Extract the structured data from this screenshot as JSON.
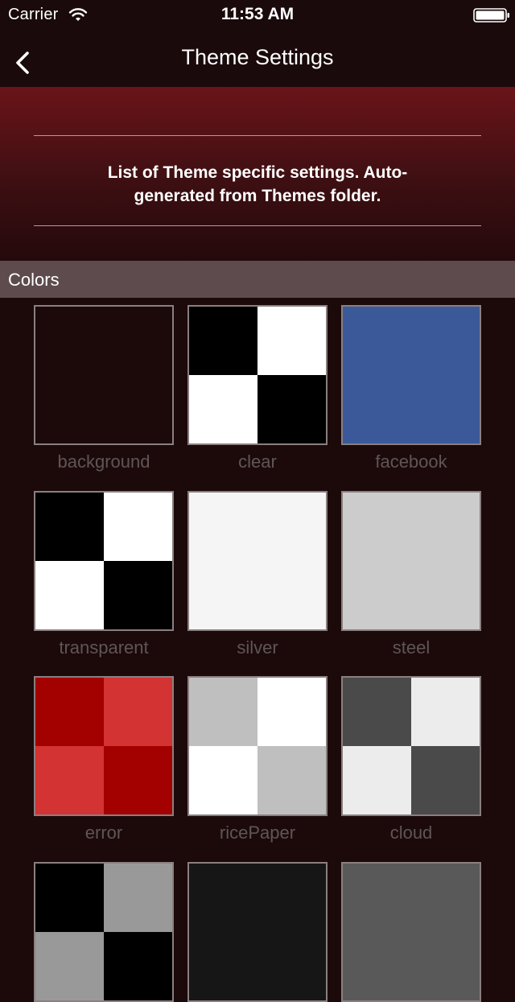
{
  "status_bar": {
    "carrier": "Carrier",
    "time": "11:53 AM"
  },
  "nav": {
    "title": "Theme Settings",
    "back_icon": "chevron-left-icon"
  },
  "header": {
    "description": "List of Theme specific settings.  Auto-generated from Themes folder."
  },
  "section": {
    "title": "Colors"
  },
  "swatches": [
    {
      "name": "background",
      "colors": [
        "#1c0a0b",
        "#1c0a0b",
        "#1c0a0b",
        "#1c0a0b"
      ]
    },
    {
      "name": "clear",
      "colors": [
        "#000000",
        "#ffffff",
        "#ffffff",
        "#000000"
      ]
    },
    {
      "name": "facebook",
      "colors": [
        "#3b5998",
        "#3b5998",
        "#3b5998",
        "#3b5998"
      ]
    },
    {
      "name": "transparent",
      "colors": [
        "#000000",
        "#ffffff",
        "#ffffff",
        "#000000"
      ]
    },
    {
      "name": "silver",
      "colors": [
        "#f5f5f5",
        "#f5f5f5",
        "#f5f5f5",
        "#f5f5f5"
      ]
    },
    {
      "name": "steel",
      "colors": [
        "#cccccc",
        "#cccccc",
        "#cccccc",
        "#cccccc"
      ]
    },
    {
      "name": "error",
      "colors": [
        "#a30000",
        "#d33333",
        "#d33333",
        "#a30000"
      ]
    },
    {
      "name": "ricePaper",
      "colors": [
        "#bfbfbf",
        "#ffffff",
        "#ffffff",
        "#bfbfbf"
      ]
    },
    {
      "name": "cloud",
      "colors": [
        "#4a4a4a",
        "#ececec",
        "#ececec",
        "#4a4a4a"
      ]
    },
    {
      "name": "",
      "colors": [
        "#000000",
        "#999999",
        "#999999",
        "#000000"
      ]
    },
    {
      "name": "",
      "colors": [
        "#161616",
        "#161616",
        "#161616",
        "#161616"
      ]
    },
    {
      "name": "",
      "colors": [
        "#595959",
        "#595959",
        "#595959",
        "#595959"
      ]
    }
  ]
}
